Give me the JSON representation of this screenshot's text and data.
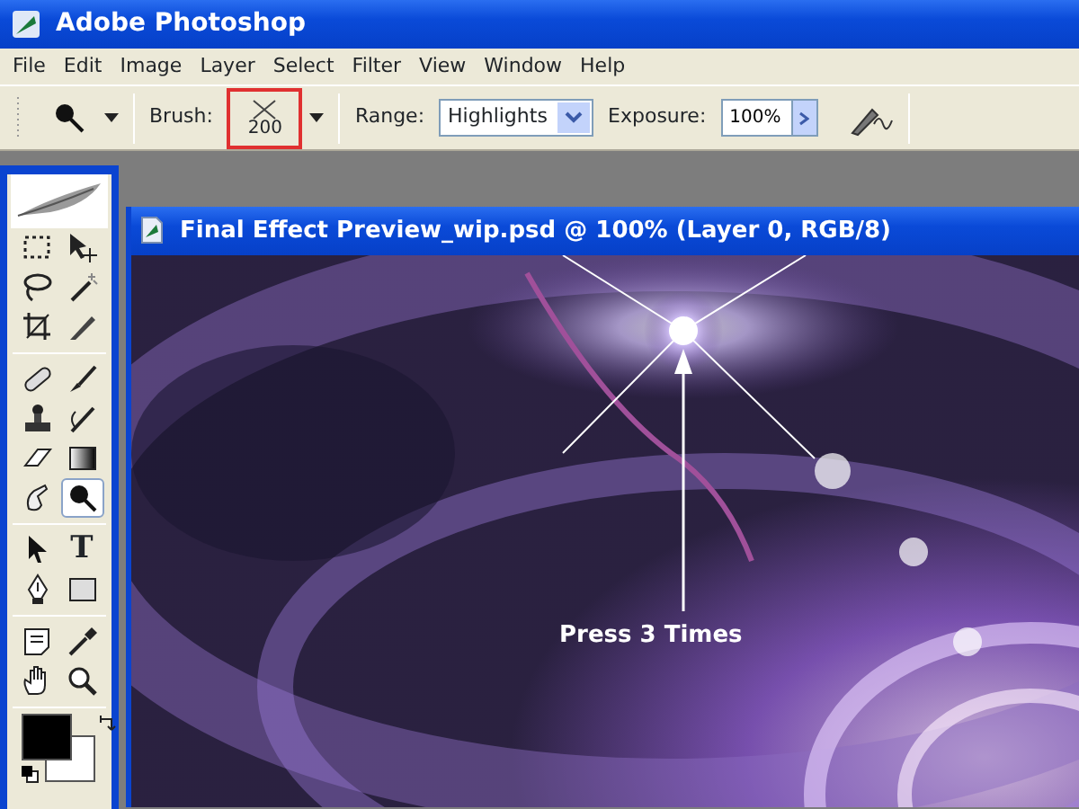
{
  "window": {
    "title": "Adobe Photoshop"
  },
  "menu": [
    {
      "label": "File"
    },
    {
      "label": "Edit"
    },
    {
      "label": "Image"
    },
    {
      "label": "Layer"
    },
    {
      "label": "Select"
    },
    {
      "label": "Filter"
    },
    {
      "label": "View"
    },
    {
      "label": "Window"
    },
    {
      "label": "Help"
    }
  ],
  "options_bar": {
    "brush_label": "Brush:",
    "brush_size": "200",
    "brush_highlighted": true,
    "range_label": "Range:",
    "range_value": "Highlights",
    "exposure_label": "Exposure:",
    "exposure_value": "100%"
  },
  "toolbox": {
    "tools": [
      {
        "kind": "marquee",
        "selected": false
      },
      {
        "kind": "move",
        "selected": false
      },
      {
        "kind": "lasso",
        "selected": false
      },
      {
        "kind": "wand",
        "selected": false
      },
      {
        "kind": "crop",
        "selected": false
      },
      {
        "kind": "slice",
        "selected": false
      },
      {
        "kind": "bandage",
        "selected": false
      },
      {
        "kind": "brush",
        "selected": false
      },
      {
        "kind": "stamp",
        "selected": false
      },
      {
        "kind": "history",
        "selected": false
      },
      {
        "kind": "eraser",
        "selected": false
      },
      {
        "kind": "gradient",
        "selected": false
      },
      {
        "kind": "smudge",
        "selected": false
      },
      {
        "kind": "dodge",
        "selected": true
      },
      {
        "kind": "arrow",
        "selected": false
      },
      {
        "kind": "type",
        "glyph": "T",
        "selected": false
      },
      {
        "kind": "pen",
        "selected": false
      },
      {
        "kind": "shape",
        "selected": false
      },
      {
        "kind": "notes",
        "selected": false
      },
      {
        "kind": "eyedropper",
        "selected": false
      },
      {
        "kind": "hand",
        "selected": false
      },
      {
        "kind": "zoom",
        "selected": false
      }
    ]
  },
  "document": {
    "title": "Final Effect Preview_wip.psd @ 100% (Layer 0, RGB/8)",
    "annotation": {
      "text": "Press 3 Times"
    }
  }
}
